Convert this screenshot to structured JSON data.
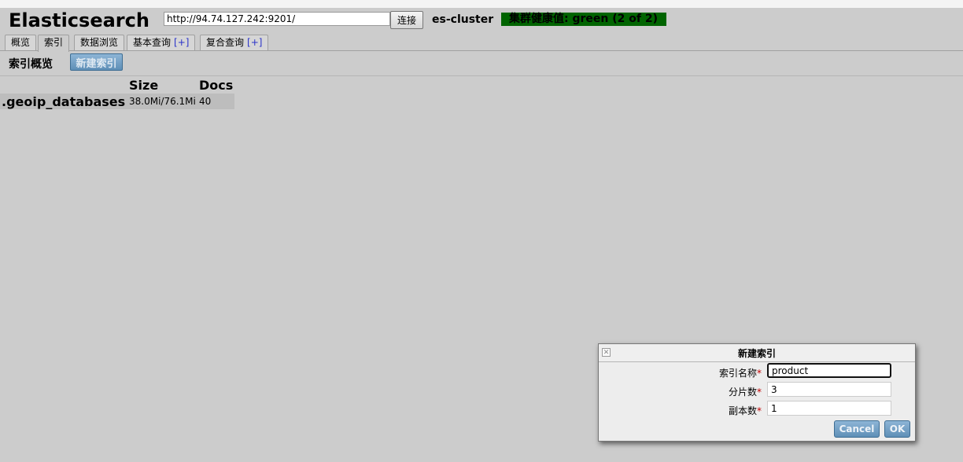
{
  "header": {
    "app_title": "Elasticsearch",
    "url_value": "http://94.74.127.242:9201/",
    "connect_label": "连接",
    "cluster_name": "es-cluster",
    "health_text": "集群健康值: green (2 of 2)",
    "health_color": "#006400"
  },
  "tabs": [
    {
      "label": "概览"
    },
    {
      "label": "索引"
    },
    {
      "label": "数据浏览"
    },
    {
      "label": "基本查询",
      "plus": "[+]"
    },
    {
      "label": "复合查询",
      "plus": "[+]"
    }
  ],
  "active_tab": "索引",
  "toolbar": {
    "title": "索引概览",
    "new_index_label": "新建索引"
  },
  "table": {
    "headers": {
      "size": "Size",
      "docs": "Docs"
    },
    "rows": [
      {
        "name": ".geoip_databases",
        "size": "38.0Mi/76.1Mi",
        "docs": "40"
      }
    ]
  },
  "dialog": {
    "title": "新建索引",
    "required_mark": "*",
    "fields": [
      {
        "label": "索引名称",
        "value": "product"
      },
      {
        "label": "分片数",
        "value": "3"
      },
      {
        "label": "副本数",
        "value": "1"
      }
    ],
    "cancel_label": "Cancel",
    "ok_label": "OK"
  }
}
